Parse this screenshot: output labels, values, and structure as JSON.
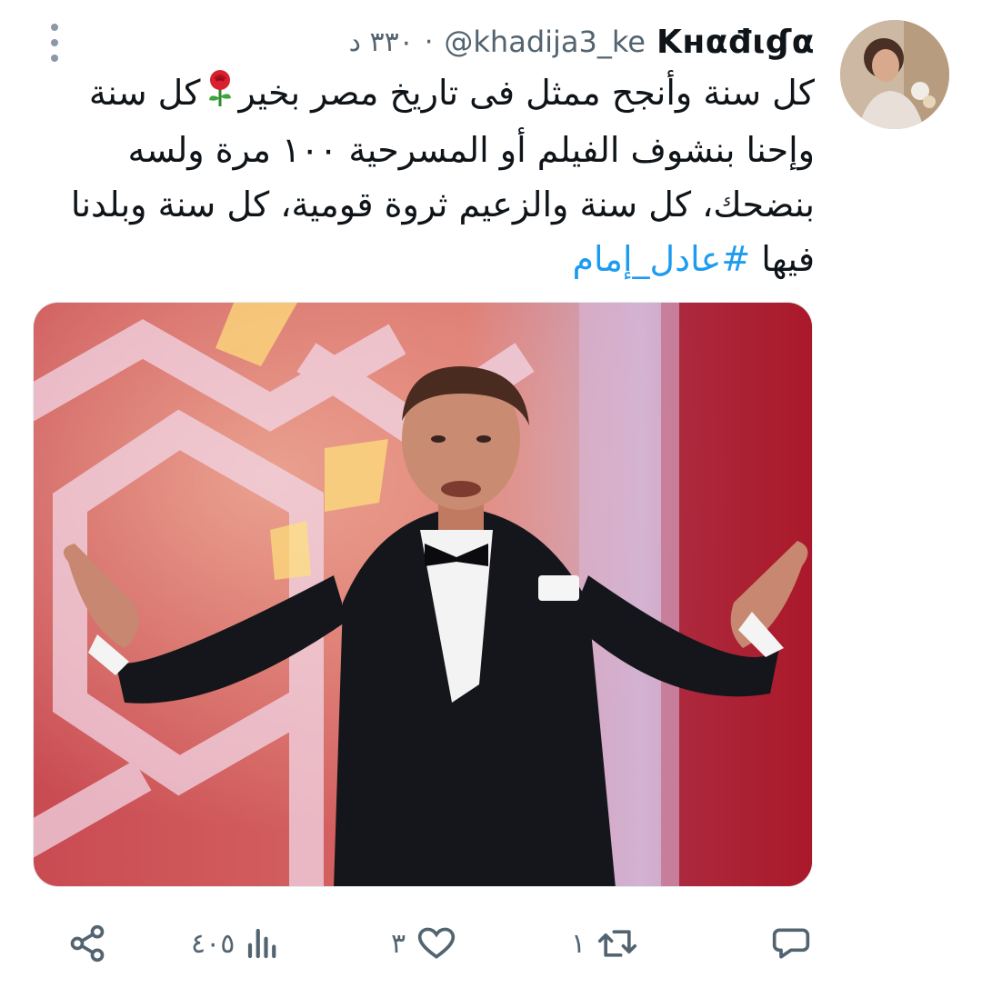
{
  "user": {
    "display_name": "Kнαđιɠα",
    "handle": "@khadija3_ke",
    "time": "٣٣٠ د",
    "separator": "·"
  },
  "tweet": {
    "line1_text": "كل سنة وأنجح ممثل فى تاريخ مصر بخير",
    "line1_tail": "كل سنة",
    "line2": "وإحنا بنشوف الفيلم أو المسرحية ١٠٠ مرة ولسه",
    "line3": "بنضحك، كل سنة والزعيم ثروة قومية، كل سنة وبلدنا",
    "line4_prefix": "فيها",
    "hashtag": "#عادل_إمام"
  },
  "icons": {
    "more": "more-vertical-icon",
    "rose": "rose-emoji",
    "share": "share-icon",
    "views": "views-icon",
    "like": "heart-icon",
    "retweet": "retweet-icon",
    "reply": "reply-icon"
  },
  "actions": {
    "views_count": "٤٠٥",
    "like_count": "٣",
    "retweet_count": "١",
    "reply_count": ""
  },
  "colors": {
    "accent": "#1d9bf0",
    "text": "#0f1419",
    "muted": "#536471"
  }
}
